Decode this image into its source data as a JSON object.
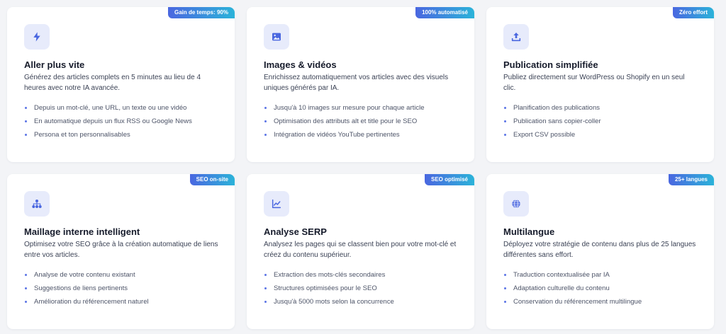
{
  "colors": {
    "accent": "#4a67e0",
    "badge_gradient_start": "#4a67e0",
    "badge_gradient_end": "#2bb3d9",
    "icon_bg": "#e7ebfb"
  },
  "cards": [
    {
      "badge": "Gain de temps: 90%",
      "icon": "lightning-bolt-icon",
      "title": "Aller plus vite",
      "description": "Générez des articles complets en 5 minutes au lieu de 4 heures avec notre IA avancée.",
      "features": [
        "Depuis un mot-clé, une URL, un texte ou une vidéo",
        "En automatique depuis un flux RSS ou Google News",
        "Persona et ton personnalisables"
      ]
    },
    {
      "badge": "100% automatisé",
      "icon": "image-icon",
      "title": "Images & vidéos",
      "description": "Enrichissez automatiquement vos articles avec des visuels uniques générés par IA.",
      "features": [
        "Jusqu'à 10 images sur mesure pour chaque article",
        "Optimisation des attributs alt et title pour le SEO",
        "Intégration de vidéos YouTube pertinentes"
      ]
    },
    {
      "badge": "Zéro effort",
      "icon": "upload-icon",
      "title": "Publication simplifiée",
      "description": "Publiez directement sur WordPress ou Shopify en un seul clic.",
      "features": [
        "Planification des publications",
        "Publication sans copier-coller",
        "Export CSV possible"
      ]
    },
    {
      "badge": "SEO on-site",
      "icon": "sitemap-icon",
      "title": "Maillage interne intelligent",
      "description": "Optimisez votre SEO grâce à la création automatique de liens entre vos articles.",
      "features": [
        "Analyse de votre contenu existant",
        "Suggestions de liens pertinents",
        "Amélioration du référencement naturel"
      ]
    },
    {
      "badge": "SEO optimisé",
      "icon": "line-chart-icon",
      "title": "Analyse SERP",
      "description": "Analysez les pages qui se classent bien pour votre mot-clé et créez du contenu supérieur.",
      "features": [
        "Extraction des mots-clés secondaires",
        "Structures optimisées pour le SEO",
        "Jusqu'à 5000 mots selon la concurrence"
      ]
    },
    {
      "badge": "25+ langues",
      "icon": "globe-icon",
      "title": "Multilangue",
      "description": "Déployez votre stratégie de contenu dans plus de 25 langues différentes sans effort.",
      "features": [
        "Traduction contextualisée par IA",
        "Adaptation culturelle du contenu",
        "Conservation du référencement multilingue"
      ]
    }
  ]
}
